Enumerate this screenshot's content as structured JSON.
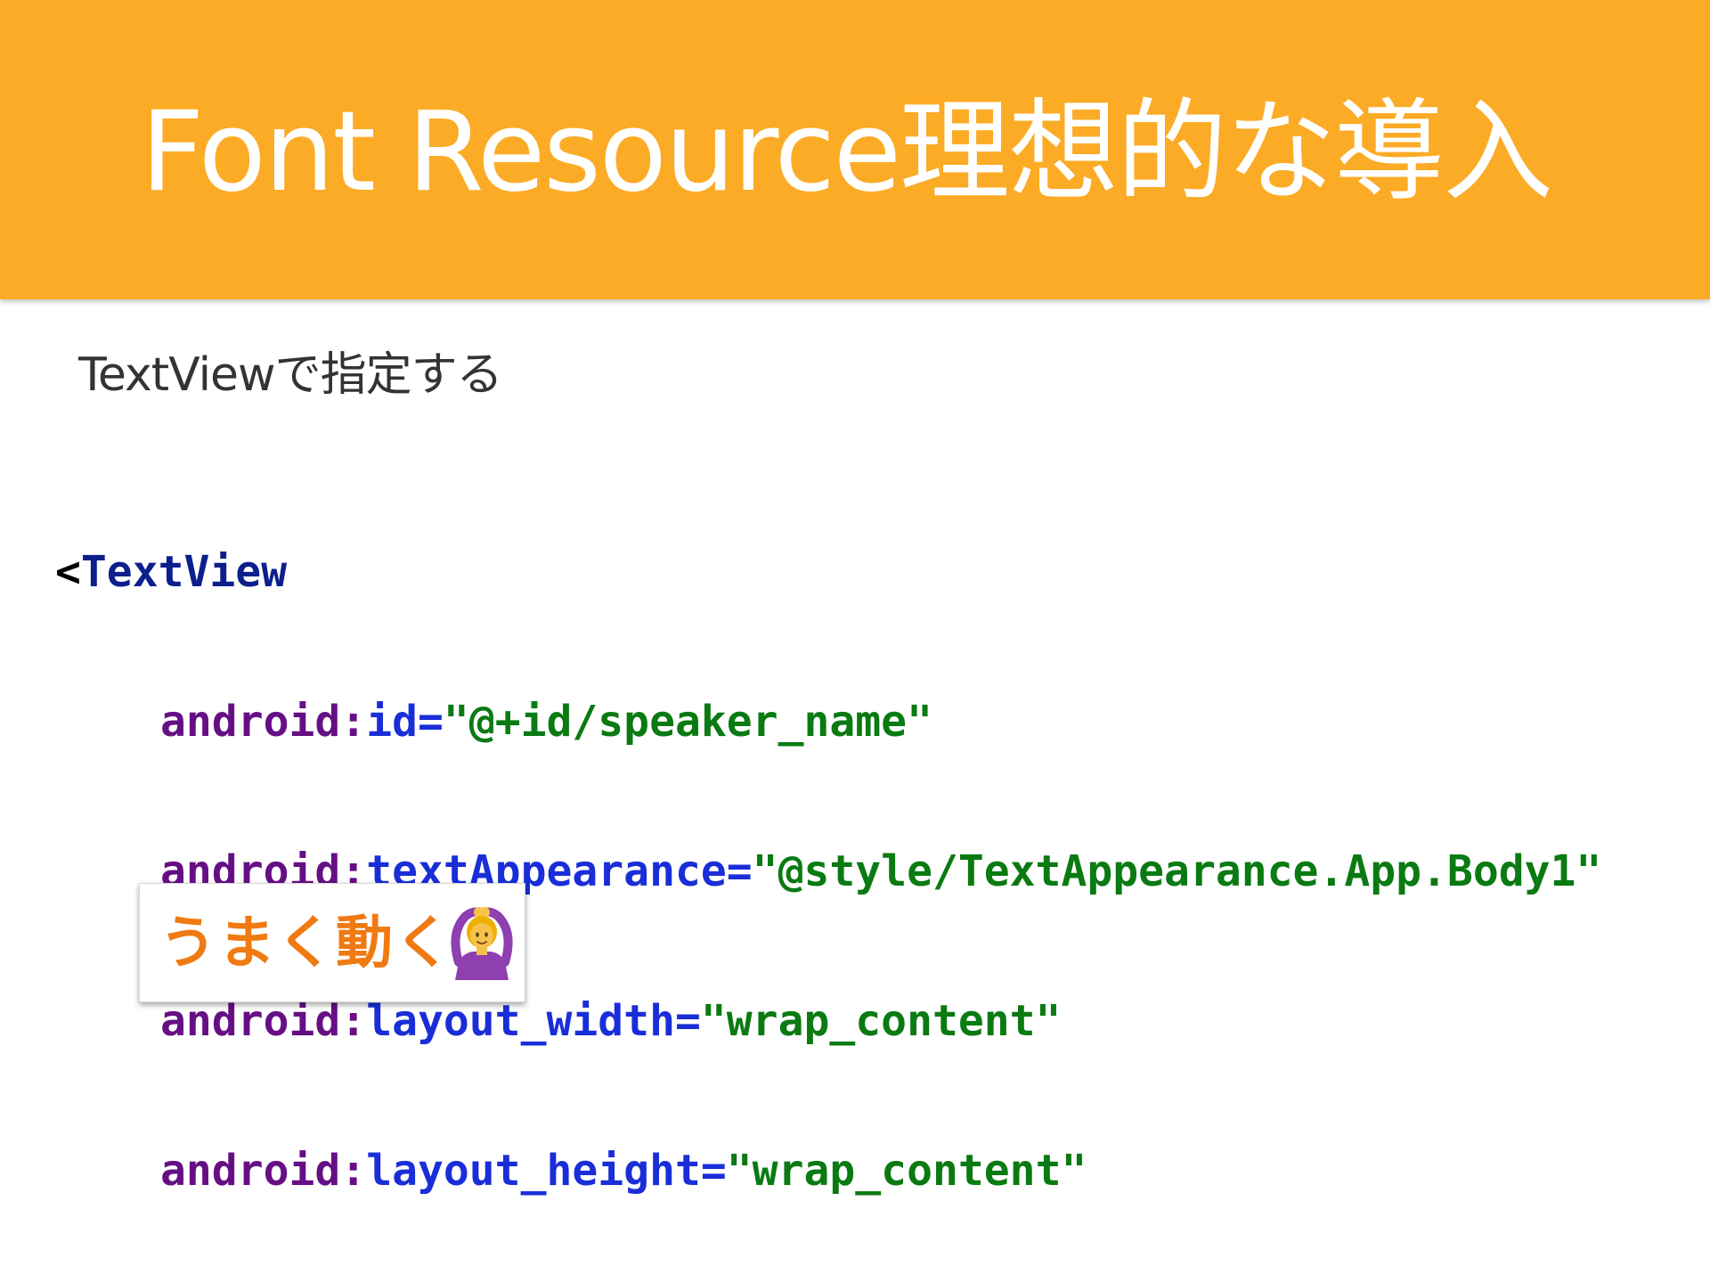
{
  "header": {
    "title": "Font Resource理想的な導入",
    "background_color": "#fbab25"
  },
  "subtitle": "TextViewで指定する",
  "code": {
    "open_bracket": "<",
    "tag_name": "TextView",
    "namespace": "android:",
    "attributes": [
      {
        "name": "id",
        "value": "\"@+id/speaker_name\""
      },
      {
        "name": "textAppearance",
        "value": "\"@style/TextAppearance.App.Body1\""
      },
      {
        "name": "layout_width",
        "value": "\"wrap_content\""
      },
      {
        "name": "layout_height",
        "value": "\"wrap_content\""
      }
    ],
    "equals": "="
  },
  "callout": {
    "text": "うまく動く",
    "icon": "woman-gesturing-ok-icon",
    "color": "#f07a12"
  }
}
